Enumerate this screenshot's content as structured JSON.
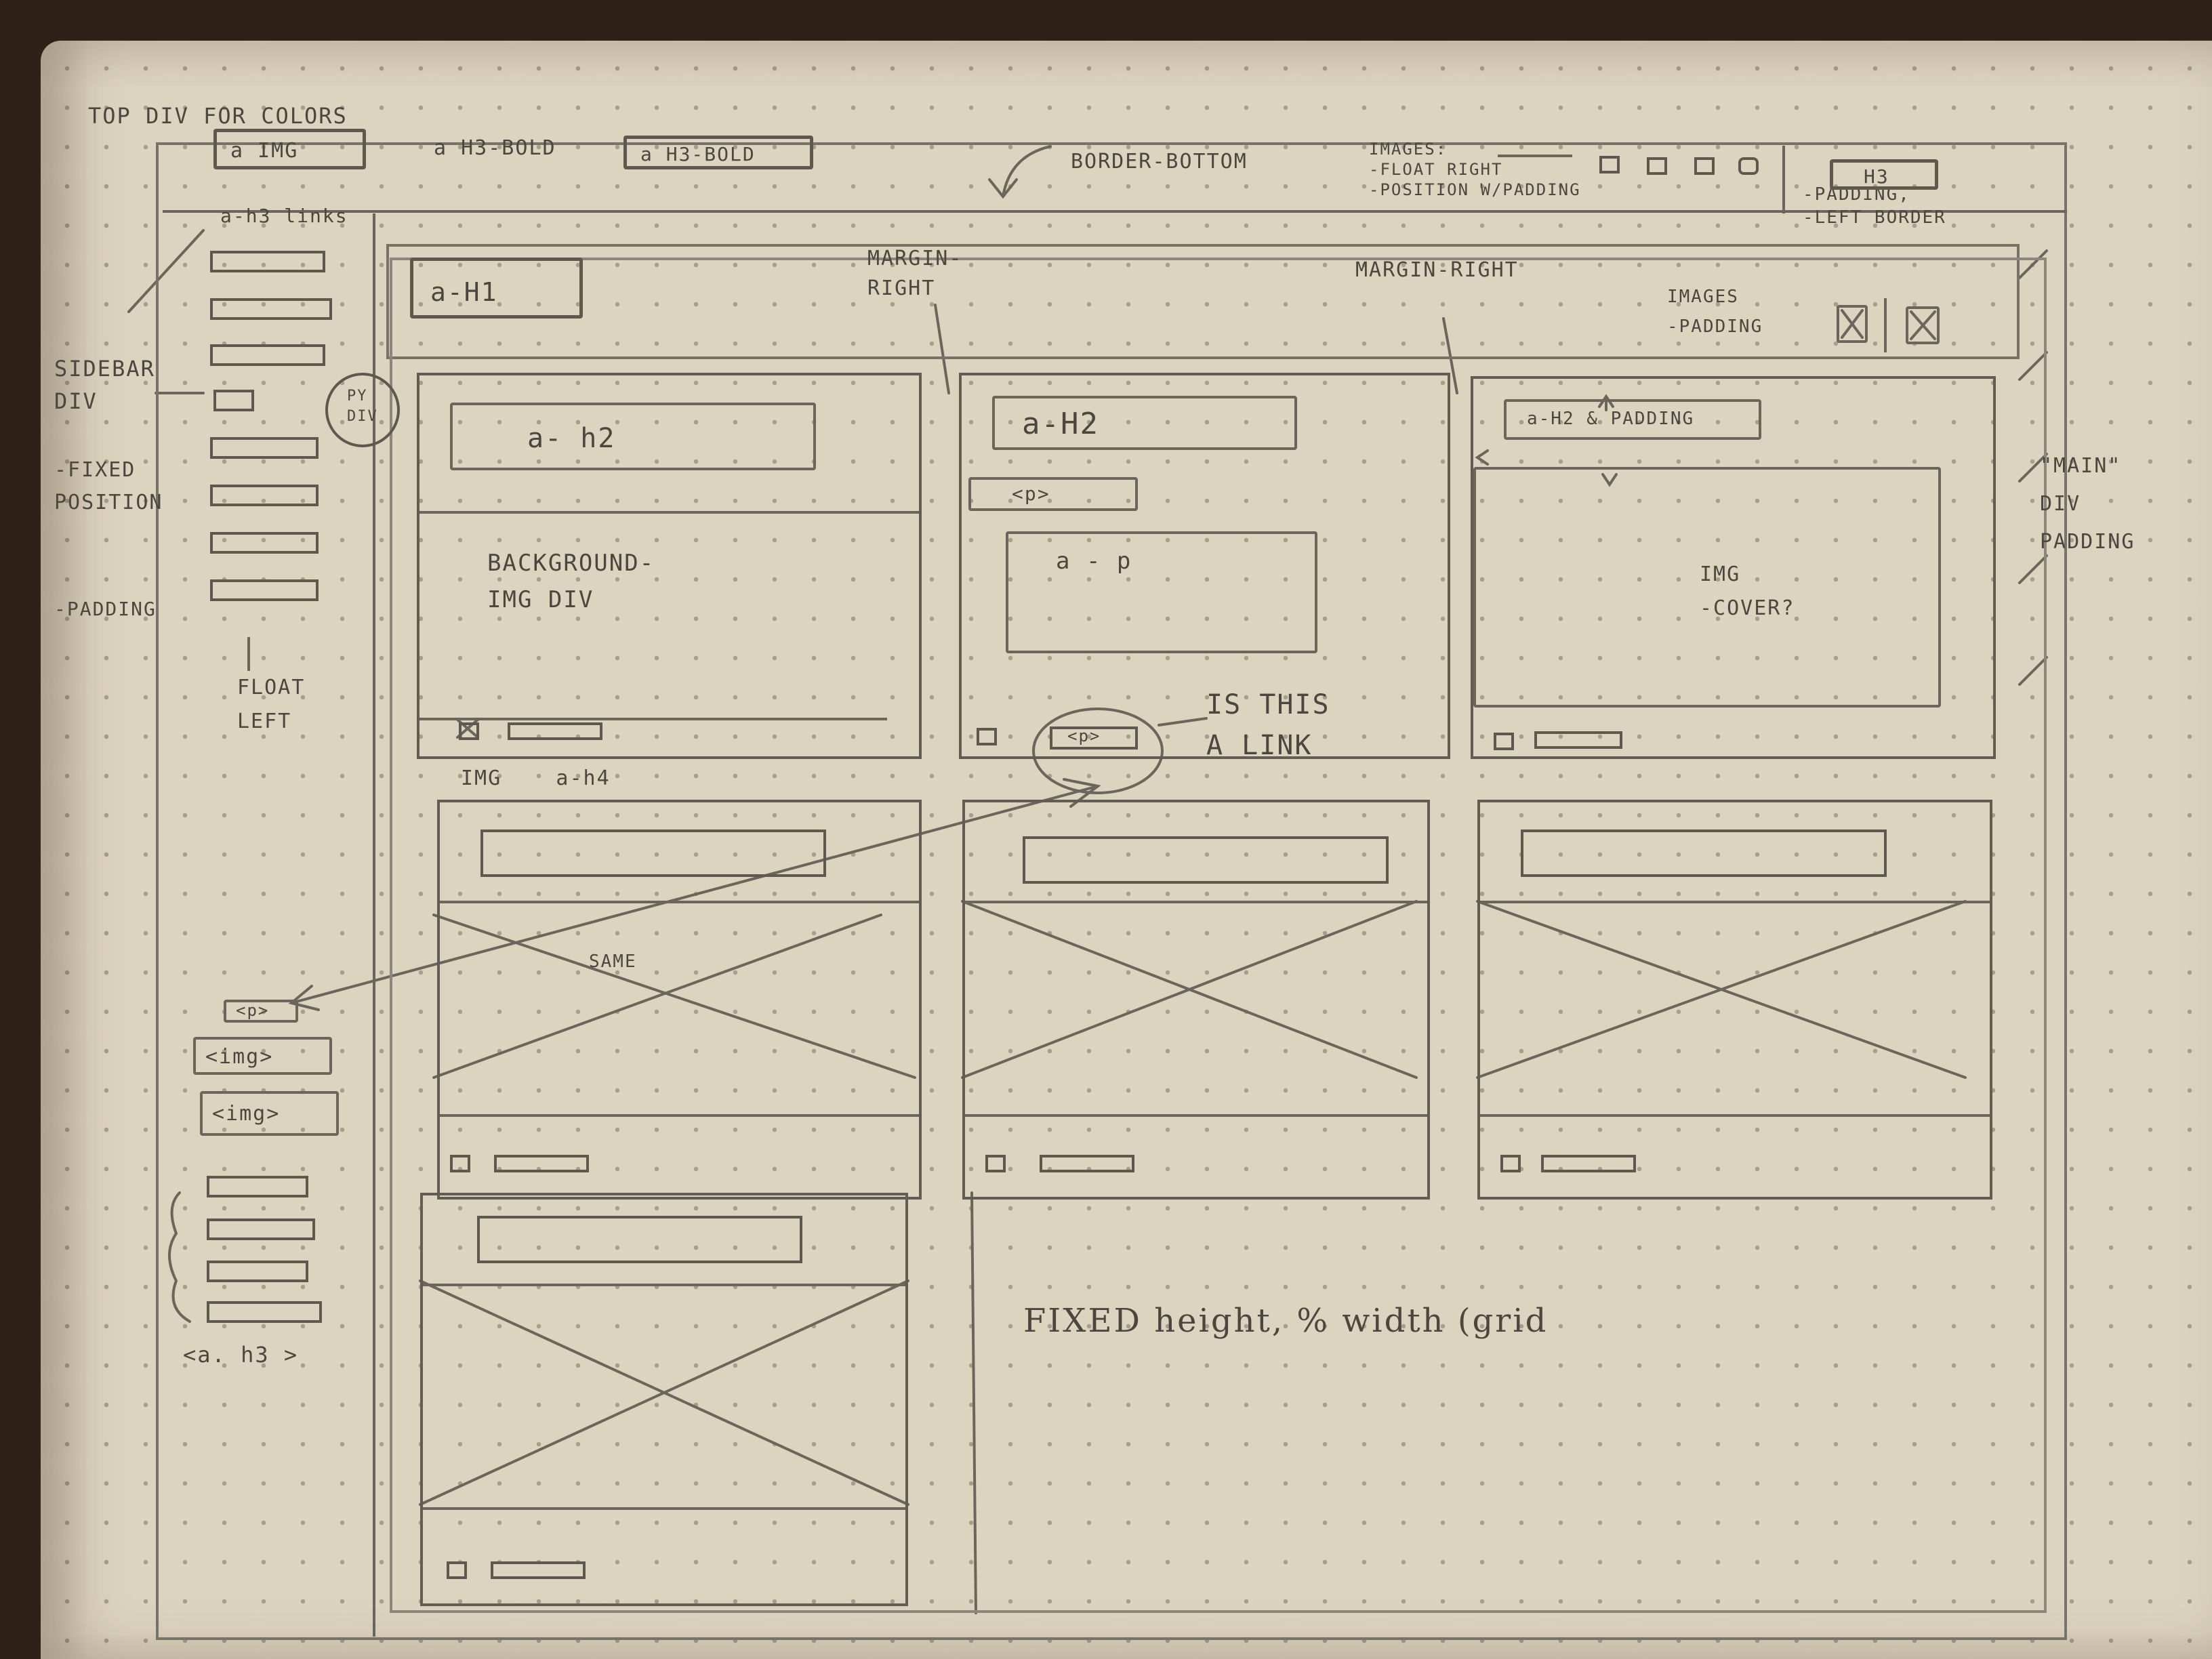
{
  "annotations": {
    "top_div": "TOP DIV FOR COLORS",
    "border_bottom": "BORDER-BOTTOM",
    "images_note": "IMAGES:\n-FLOAT RIGHT\n-POSITION W/PADDING",
    "h3_note": "-PADDING,\n-LEFT BORDER",
    "a_h3_links": "a-h3 links",
    "sidebar_div": "SIDEBAR\nDIV",
    "fixed_position": "-FIXED\nPOSITION",
    "padding_left": "-PADDING",
    "float_left": "FLOAT\nLEFT",
    "py_div": "PY\nDIV",
    "margin_right_1": "MARGIN-\nRIGHT",
    "margin_right_2": "MARGIN-RIGHT",
    "images_padding": "IMAGES\n-PADDING",
    "main_div": "\"MAIN\"\nDIV\nPADDING",
    "background_img_div": "BACKGROUND-\nIMG DIV",
    "img_cover": "IMG\n-COVER?",
    "is_this_a_link": "IS THIS\nA LINK",
    "img_a_h4": "IMG    a-h4",
    "same": "SAME",
    "fixed_height": "FIXED height, % width (grid"
  },
  "header": {
    "a_img": "a IMG",
    "a_h3_bold_1": "a H3-BOLD",
    "a_h3_bold_2": "a H3-BOLD",
    "h3": "H3"
  },
  "subheader": {
    "a_h1": "a-H1"
  },
  "cards": {
    "card1_title": "a- h2",
    "card2_title": "a-H2",
    "card2_p": "<p>",
    "card2_ap": "a - p",
    "card2_footer_p": "<p>",
    "card3_title": "a-H2 & PADDING"
  },
  "sidebar": {
    "p_tag": "<p>",
    "img_1": "<img>",
    "img_2": "<img>",
    "a_h3": "<a. h3 >"
  }
}
